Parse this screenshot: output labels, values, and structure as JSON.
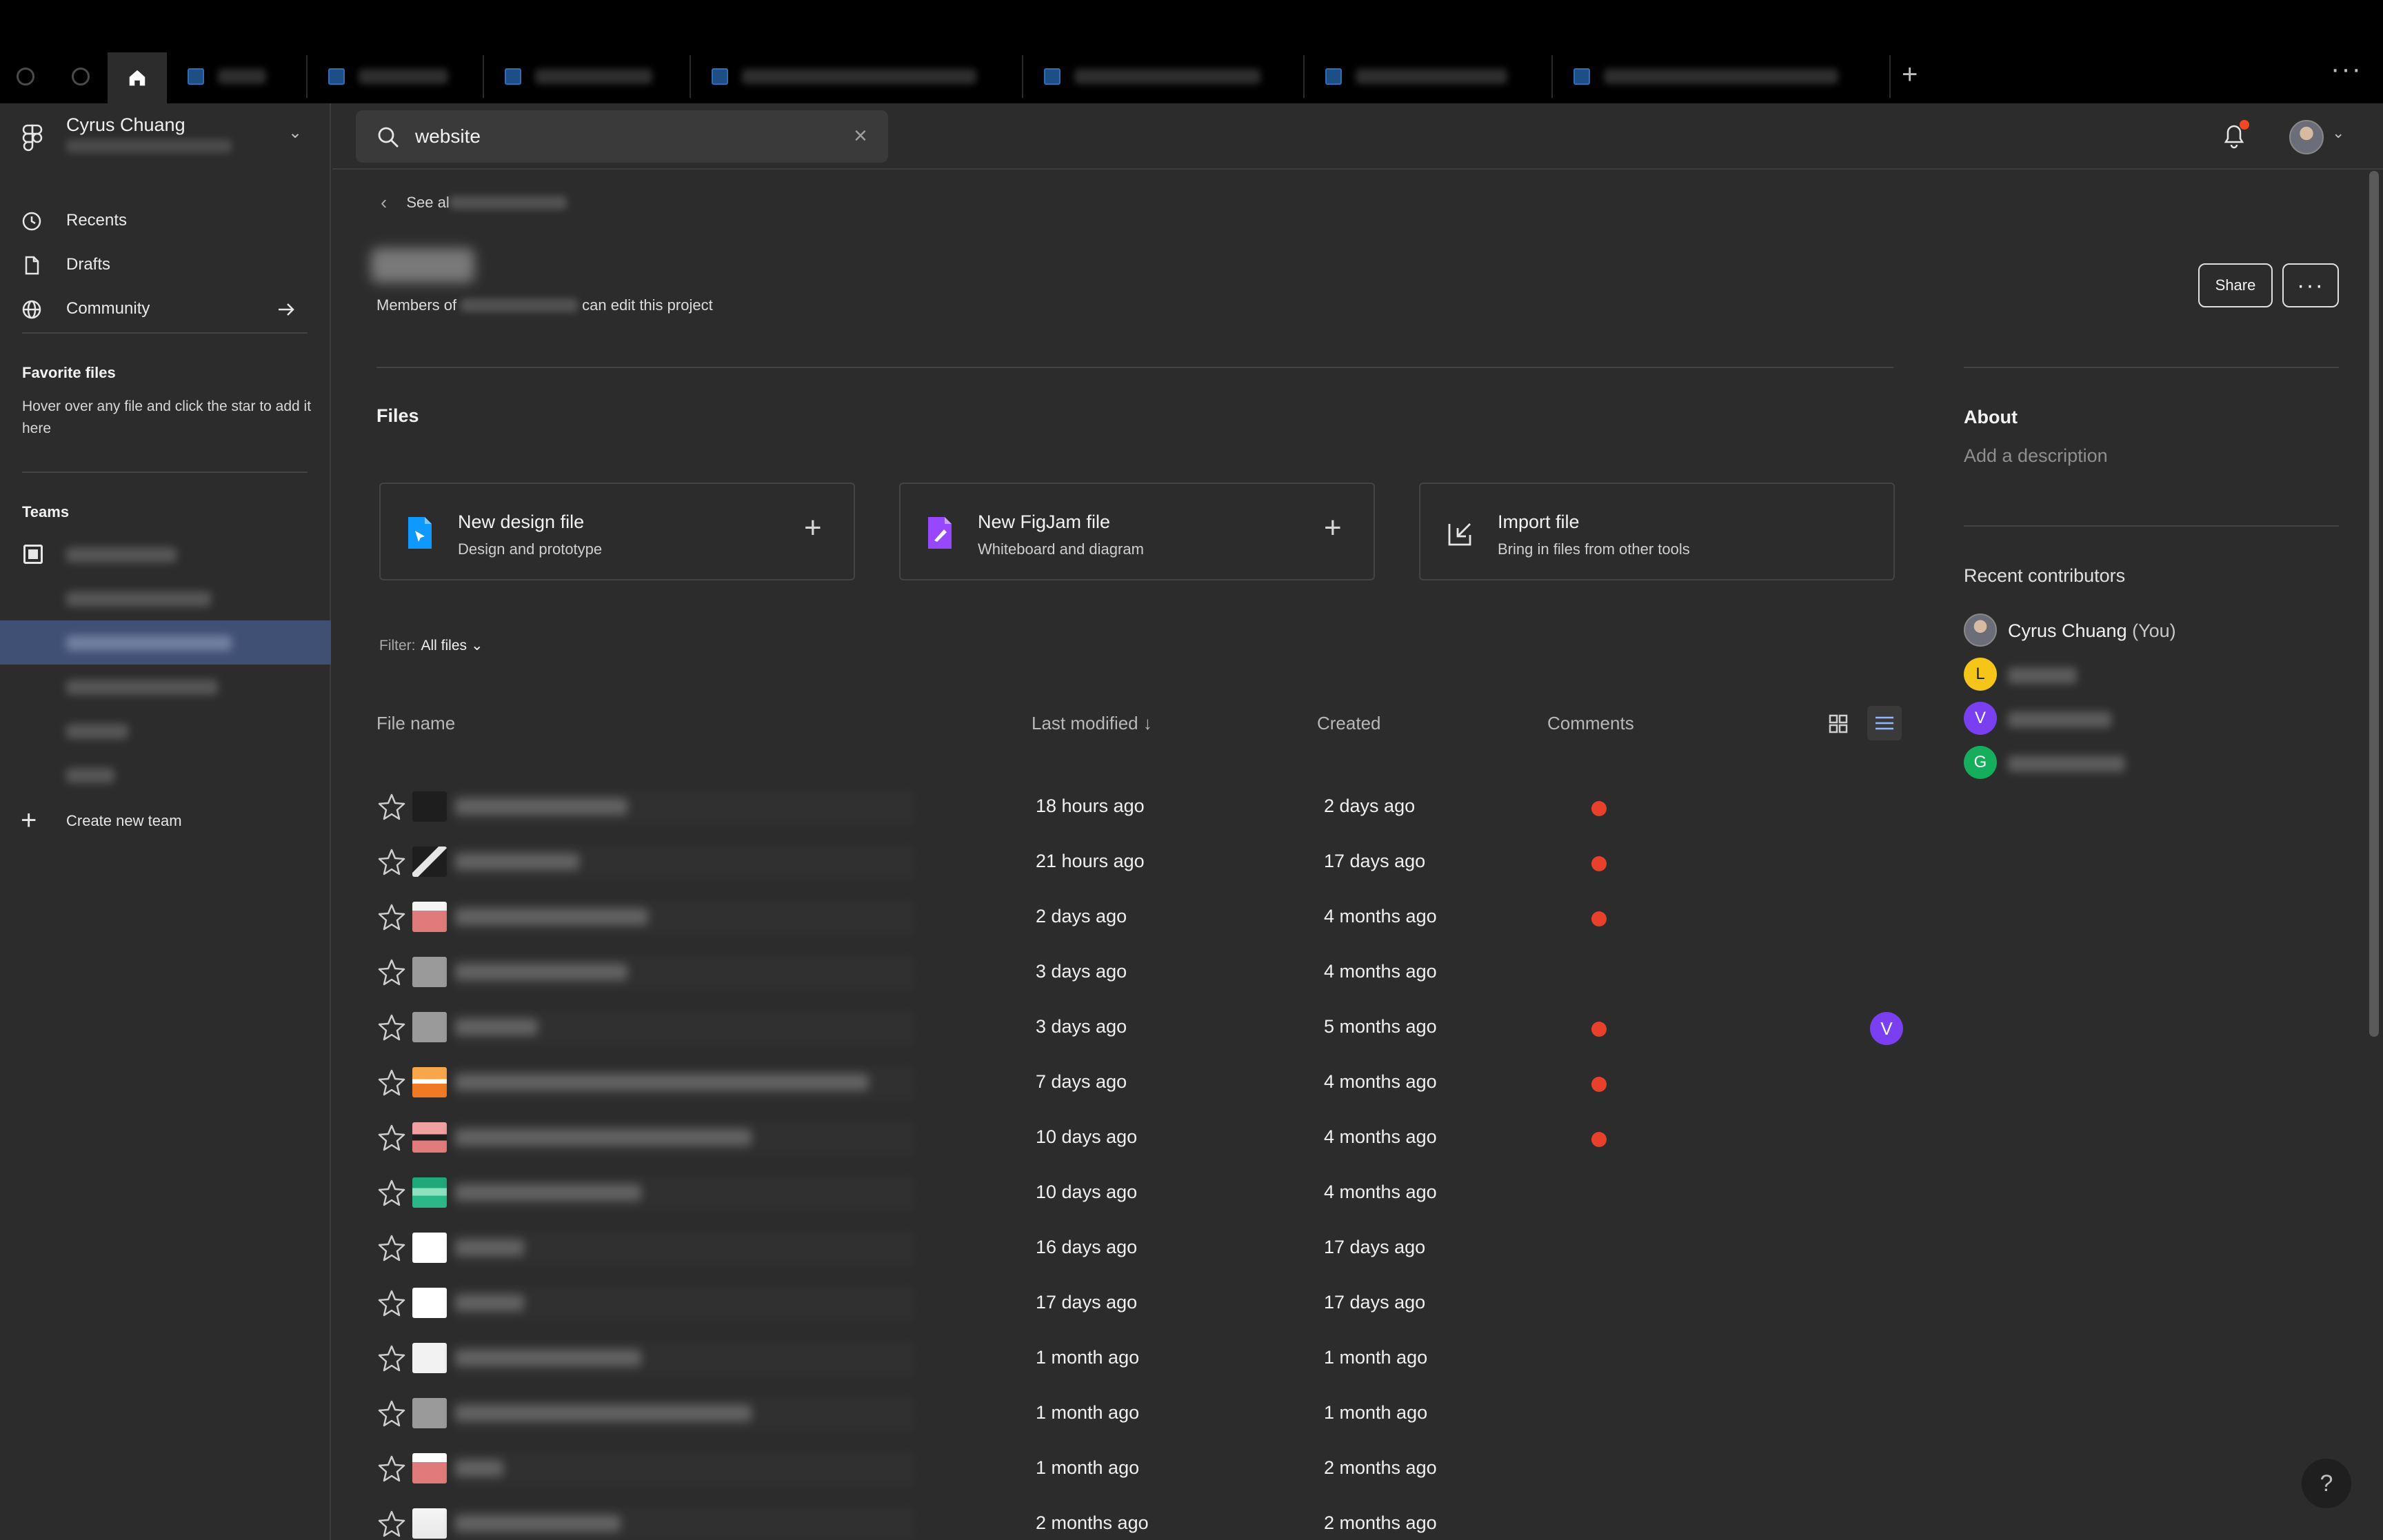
{
  "tabs": {
    "home_icon": "home-icon",
    "new_tab_label": "+",
    "overflow_label": "···"
  },
  "account": {
    "name": "Cyrus Chuang",
    "chevron": "⌄"
  },
  "nav": {
    "recents": "Recents",
    "drafts": "Drafts",
    "community": "Community"
  },
  "favorites": {
    "title": "Favorite files",
    "hint": "Hover over any file and click the star to add it here"
  },
  "teams": {
    "title": "Teams",
    "create_label": "Create new team"
  },
  "search": {
    "value": "website",
    "clear": "×"
  },
  "project": {
    "breadcrumb_prefix": "See al",
    "members_prefix": "Members of",
    "members_suffix": "can edit this project",
    "share_label": "Share",
    "more_label": "···"
  },
  "files": {
    "title": "Files",
    "filter_label": "Filter:",
    "filter_value": "All files",
    "create_cards": [
      {
        "title": "New design file",
        "subtitle": "Design and prototype",
        "plus": "+"
      },
      {
        "title": "New FigJam file",
        "subtitle": "Whiteboard and diagram",
        "plus": "+"
      },
      {
        "title": "Import file",
        "subtitle": "Bring in files from other tools"
      }
    ],
    "columns": {
      "name": "File name",
      "modified": "Last modified ↓",
      "created": "Created",
      "comments": "Comments"
    },
    "rows": [
      {
        "modified": "18 hours ago",
        "created": "2 days ago",
        "comment_dot": true
      },
      {
        "modified": "21 hours ago",
        "created": "17 days ago",
        "comment_dot": true
      },
      {
        "modified": "2 days ago",
        "created": "4 months ago",
        "comment_dot": true
      },
      {
        "modified": "3 days ago",
        "created": "4 months ago",
        "comment_dot": false
      },
      {
        "modified": "3 days ago",
        "created": "5 months ago",
        "comment_dot": true,
        "contributor": "V"
      },
      {
        "modified": "7 days ago",
        "created": "4 months ago",
        "comment_dot": true
      },
      {
        "modified": "10 days ago",
        "created": "4 months ago",
        "comment_dot": true
      },
      {
        "modified": "10 days ago",
        "created": "4 months ago",
        "comment_dot": false
      },
      {
        "modified": "16 days ago",
        "created": "17 days ago",
        "comment_dot": false
      },
      {
        "modified": "17 days ago",
        "created": "17 days ago",
        "comment_dot": false
      },
      {
        "modified": "1 month ago",
        "created": "1 month ago",
        "comment_dot": false
      },
      {
        "modified": "1 month ago",
        "created": "1 month ago",
        "comment_dot": false
      },
      {
        "modified": "1 month ago",
        "created": "2 months ago",
        "comment_dot": false
      },
      {
        "modified": "2 months ago",
        "created": "2 months ago",
        "comment_dot": false
      }
    ]
  },
  "about": {
    "title": "About",
    "placeholder": "Add a description"
  },
  "contributors": {
    "title": "Recent contributors",
    "list": [
      {
        "name": "Cyrus Chuang",
        "suffix": "(You)"
      },
      {
        "initial": "L",
        "color": "#f5c518"
      },
      {
        "initial": "V",
        "color": "#7b3ff2"
      },
      {
        "initial": "G",
        "color": "#14ae5c"
      }
    ]
  },
  "help": {
    "label": "?"
  },
  "colors": {
    "accent_active": "#405075",
    "comment_dot": "#e8412b",
    "notification_dot": "#f24822"
  }
}
